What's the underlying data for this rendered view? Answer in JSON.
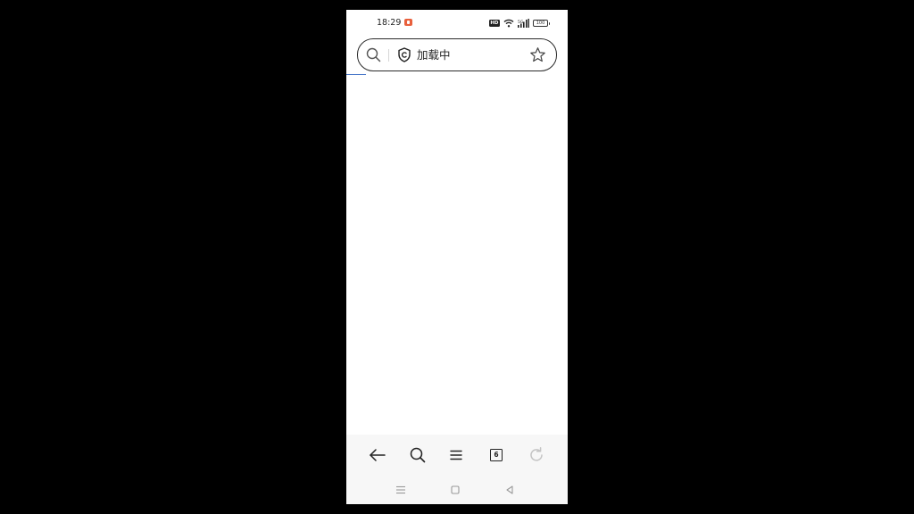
{
  "status_bar": {
    "time": "18:29",
    "hd_label": "HD",
    "battery_level": "100",
    "app_icon_color": "#e8603c"
  },
  "address_bar": {
    "text": "加载中",
    "icons": [
      "search-icon",
      "shield-icon",
      "star-icon"
    ]
  },
  "loading": {
    "progress_percent": 9,
    "color": "#4a78c9"
  },
  "toolbar": {
    "tabs_count": "6",
    "buttons": [
      "back-arrow-icon",
      "search-icon",
      "menu-icon",
      "tabs-icon",
      "refresh-icon"
    ]
  },
  "system_nav": {
    "buttons": [
      "recents-icon",
      "home-icon",
      "back-icon"
    ]
  }
}
